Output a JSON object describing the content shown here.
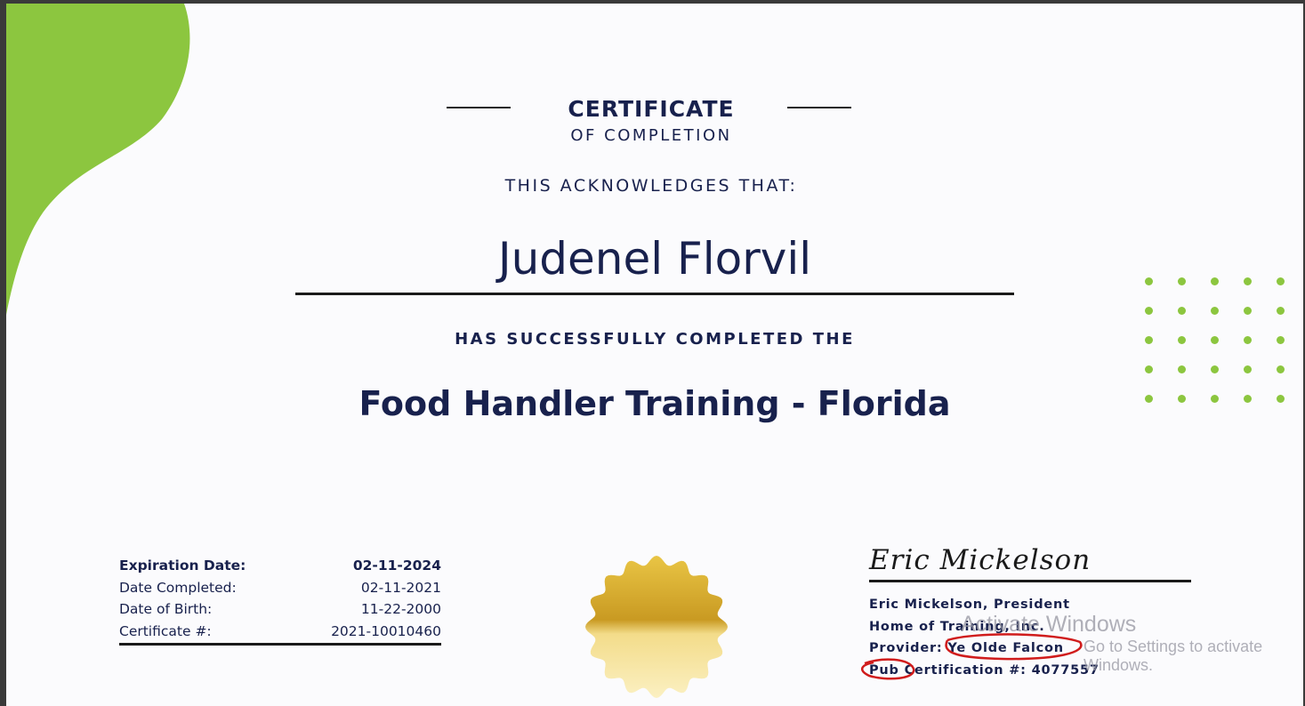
{
  "certificate": {
    "title": "CERTIFICATE",
    "subtitle": "OF COMPLETION",
    "acknowledges": "THIS ACKNOWLEDGES THAT:",
    "recipient": "Judenel Florvil",
    "completed_text": "HAS SUCCESSFULLY COMPLETED THE",
    "course": "Food Handler Training - Florida"
  },
  "details": [
    {
      "label": "Expiration Date:",
      "value": "02-11-2024",
      "bold": true
    },
    {
      "label": "Date Completed:",
      "value": "02-11-2021",
      "bold": false
    },
    {
      "label": "Date of Birth:",
      "value": "11-22-2000",
      "bold": false
    },
    {
      "label": "Certificate #:",
      "value": "2021-10010460",
      "bold": false
    }
  ],
  "signature": {
    "script": "Eric Mickelson",
    "lines": [
      "Eric Mickelson, President",
      "Home of Training, Inc.",
      "Provider: Ye Olde Falcon",
      "Pub Certification #: 4077557"
    ]
  },
  "watermark": {
    "title": "Activate Windows",
    "subtitle": "Go to Settings to activate Windows."
  },
  "colors": {
    "navy": "#18214d",
    "green": "#8cc63f",
    "annotation_red": "#d01c1c",
    "gold": "#d4a82a"
  }
}
